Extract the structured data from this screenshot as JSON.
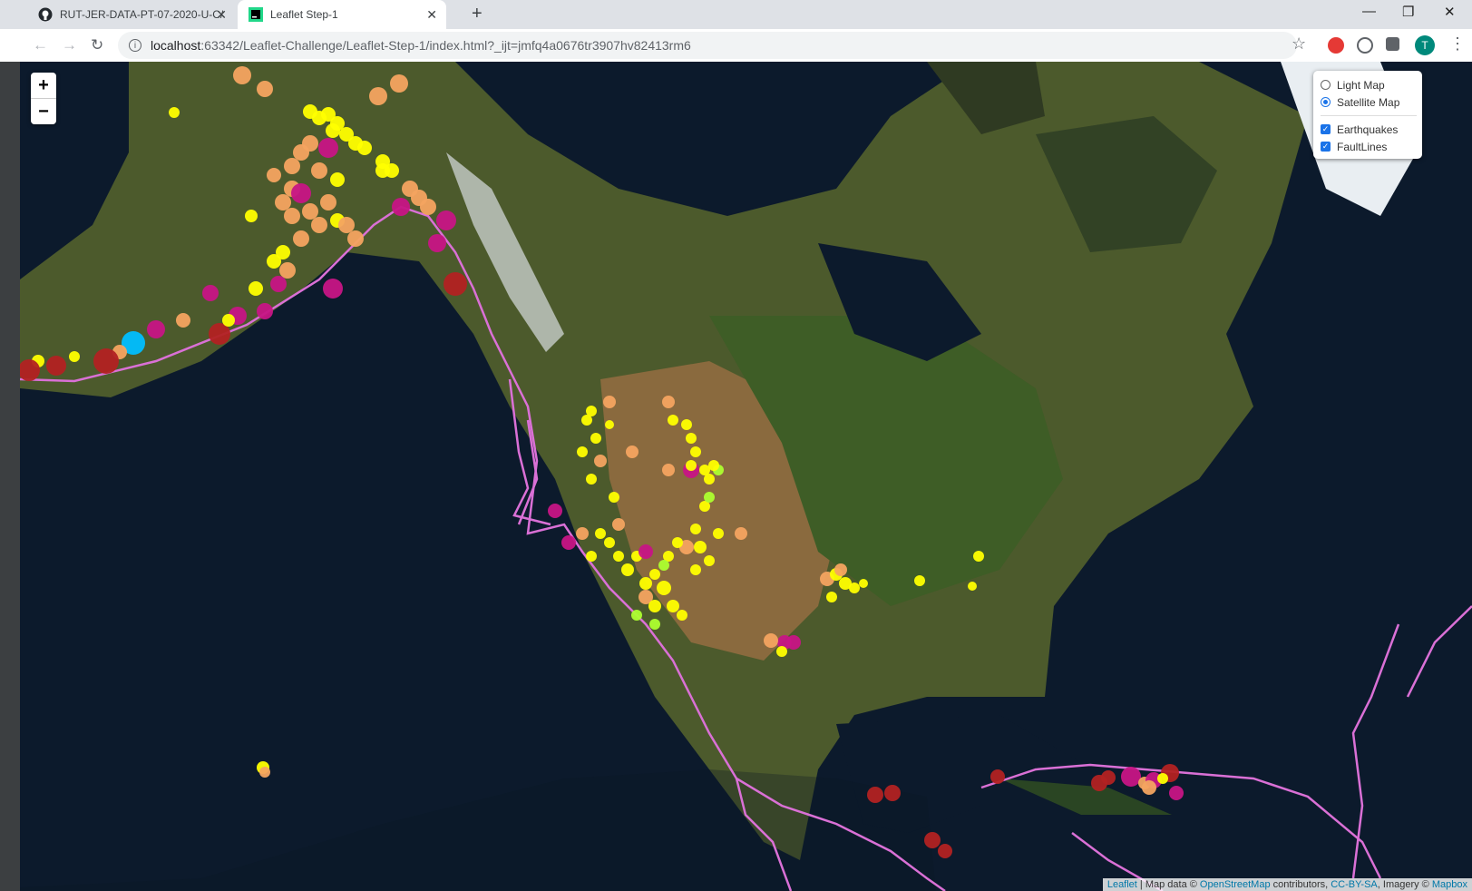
{
  "browser": {
    "tabs": [
      {
        "title": "RUT-JER-DATA-PT-07-2020-U-C/",
        "active": false
      },
      {
        "title": "Leaflet Step-1",
        "active": true
      }
    ],
    "url_host": "localhost",
    "url_path": ":63342/Leaflet-Challenge/Leaflet-Step-1/index.html?_ijt=jmfq4a0676tr3907hv82413rm6",
    "profile_initial": "T"
  },
  "map": {
    "zoom_in": "+",
    "zoom_out": "−",
    "layers": {
      "base_layers": [
        "Light Map",
        "Satellite Map"
      ],
      "selected_base": "Satellite Map",
      "overlays": [
        "Earthquakes",
        "FaultLines"
      ],
      "overlays_checked": [
        true,
        true
      ]
    },
    "attribution": {
      "leaflet": "Leaflet",
      "text1": " | Map data © ",
      "osm": "OpenStreetMap",
      "text2": " contributors, ",
      "license": "CC-BY-SA",
      "text3": ", Imagery © ",
      "provider": "Mapbox"
    },
    "marker_colors": {
      "mag_low": "#adff2f",
      "mag_1": "#ffff00",
      "mag_2": "#f4a460",
      "mag_3": "#c71585",
      "mag_4": "#b22222",
      "mag_5": "#00bfff",
      "fault_line": "#da70d6"
    }
  }
}
